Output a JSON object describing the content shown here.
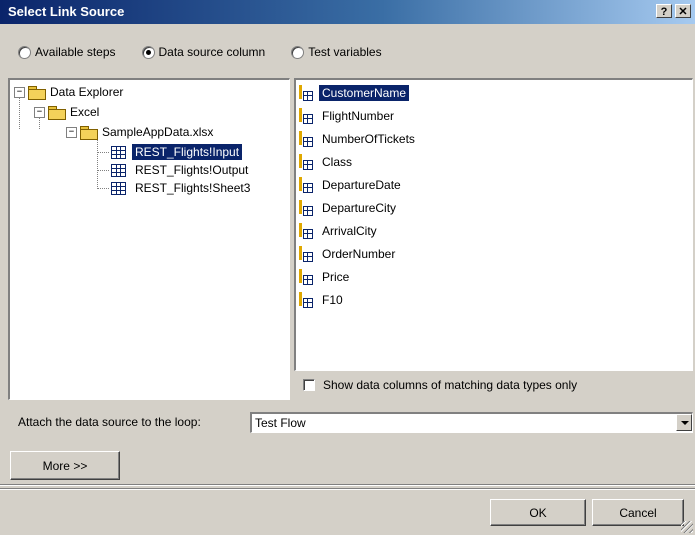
{
  "window": {
    "title": "Select Link Source",
    "help_label": "?",
    "close_label": "✕"
  },
  "radios": [
    {
      "label": "Available steps",
      "checked": false
    },
    {
      "label": "Data source column",
      "checked": true
    },
    {
      "label": "Test variables",
      "checked": false
    }
  ],
  "tree": {
    "root": "Data Explorer",
    "excel": "Excel",
    "file": "SampleAppData.xlsx",
    "sheets": [
      "REST_Flights!Input",
      "REST_Flights!Output",
      "REST_Flights!Sheet3"
    ],
    "selected_sheet": "REST_Flights!Input"
  },
  "columns": {
    "items": [
      "CustomerName",
      "FlightNumber",
      "NumberOfTickets",
      "Class",
      "DepartureDate",
      "DepartureCity",
      "ArrivalCity",
      "OrderNumber",
      "Price",
      "F10"
    ],
    "selected": "CustomerName"
  },
  "match_types": {
    "label": "Show data columns of matching data types only",
    "checked": false
  },
  "loop": {
    "label": "Attach the data source to the loop:",
    "value": "Test Flow"
  },
  "buttons": {
    "more": "More >>",
    "ok": "OK",
    "cancel": "Cancel"
  }
}
